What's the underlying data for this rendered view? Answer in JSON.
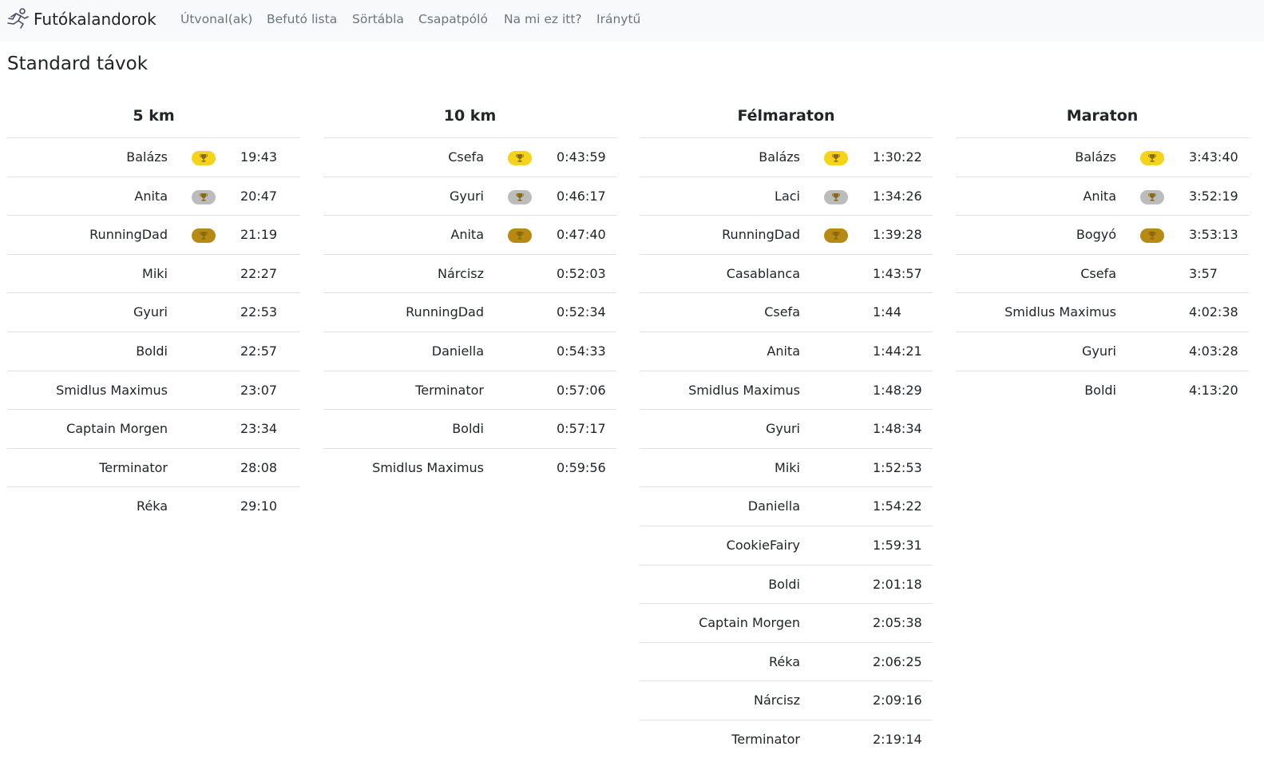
{
  "navbar": {
    "brand": "Futókalandorok",
    "links": [
      "Útvonal(ak)",
      "Befutó lista",
      "Sörtábla",
      "Csapatpóló",
      "Na mi ez itt?",
      "Iránytű"
    ]
  },
  "page": {
    "title": "Standard távok"
  },
  "colors": {
    "gold": "#f4d31a",
    "silver": "#bcbcbc",
    "bronze": "#b88a14"
  },
  "distances": [
    {
      "title": "5 km",
      "rows": [
        {
          "name": "Balázs",
          "time": "19:43",
          "medal": "gold"
        },
        {
          "name": "Anita",
          "time": "20:47",
          "medal": "silver"
        },
        {
          "name": "RunningDad",
          "time": "21:19",
          "medal": "bronze"
        },
        {
          "name": "Miki",
          "time": "22:27"
        },
        {
          "name": "Gyuri",
          "time": "22:53"
        },
        {
          "name": "Boldi",
          "time": "22:57"
        },
        {
          "name": "Smidlus Maximus",
          "time": "23:07"
        },
        {
          "name": "Captain Morgen",
          "time": "23:34"
        },
        {
          "name": "Terminator",
          "time": "28:08"
        },
        {
          "name": "Réka",
          "time": "29:10"
        }
      ]
    },
    {
      "title": "10 km",
      "rows": [
        {
          "name": "Csefa",
          "time": "0:43:59",
          "medal": "gold"
        },
        {
          "name": "Gyuri",
          "time": "0:46:17",
          "medal": "silver"
        },
        {
          "name": "Anita",
          "time": "0:47:40",
          "medal": "bronze"
        },
        {
          "name": "Nárcisz",
          "time": "0:52:03"
        },
        {
          "name": "RunningDad",
          "time": "0:52:34"
        },
        {
          "name": "Daniella",
          "time": "0:54:33"
        },
        {
          "name": "Terminator",
          "time": "0:57:06"
        },
        {
          "name": "Boldi",
          "time": "0:57:17"
        },
        {
          "name": "Smidlus Maximus",
          "time": "0:59:56"
        }
      ]
    },
    {
      "title": "Félmaraton",
      "rows": [
        {
          "name": "Balázs",
          "time": "1:30:22",
          "medal": "gold"
        },
        {
          "name": "Laci",
          "time": "1:34:26",
          "medal": "silver"
        },
        {
          "name": "RunningDad",
          "time": "1:39:28",
          "medal": "bronze"
        },
        {
          "name": "Casablanca",
          "time": "1:43:57"
        },
        {
          "name": "Csefa",
          "time": "1:44"
        },
        {
          "name": "Anita",
          "time": "1:44:21"
        },
        {
          "name": "Smidlus Maximus",
          "time": "1:48:29"
        },
        {
          "name": "Gyuri",
          "time": "1:48:34"
        },
        {
          "name": "Miki",
          "time": "1:52:53"
        },
        {
          "name": "Daniella",
          "time": "1:54:22"
        },
        {
          "name": "CookieFairy",
          "time": "1:59:31"
        },
        {
          "name": "Boldi",
          "time": "2:01:18"
        },
        {
          "name": "Captain Morgen",
          "time": "2:05:38"
        },
        {
          "name": "Réka",
          "time": "2:06:25"
        },
        {
          "name": "Nárcisz",
          "time": "2:09:16"
        },
        {
          "name": "Terminator",
          "time": "2:19:14"
        }
      ]
    },
    {
      "title": "Maraton",
      "rows": [
        {
          "name": "Balázs",
          "time": "3:43:40",
          "medal": "gold"
        },
        {
          "name": "Anita",
          "time": "3:52:19",
          "medal": "silver"
        },
        {
          "name": "Bogyó",
          "time": "3:53:13",
          "medal": "bronze"
        },
        {
          "name": "Csefa",
          "time": "3:57"
        },
        {
          "name": "Smidlus Maximus",
          "time": "4:02:38"
        },
        {
          "name": "Gyuri",
          "time": "4:03:28"
        },
        {
          "name": "Boldi",
          "time": "4:13:20"
        }
      ]
    }
  ]
}
